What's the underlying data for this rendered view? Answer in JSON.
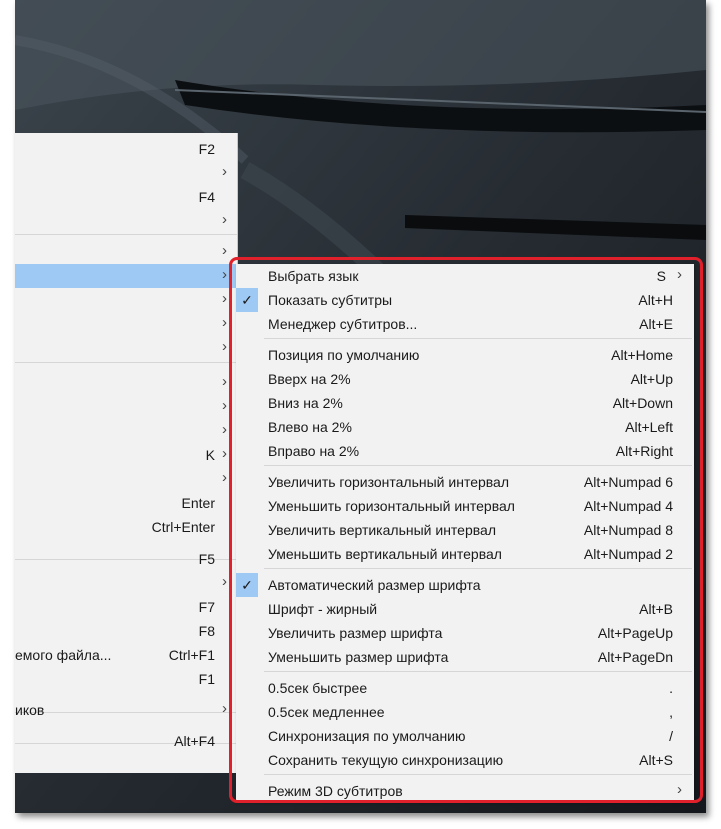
{
  "main_menu": {
    "rows": [
      {
        "left": "",
        "shortcut": "F2",
        "arrow": ""
      },
      {
        "left": "",
        "shortcut": "",
        "arrow": "›"
      },
      {
        "left": "",
        "shortcut": "F4",
        "arrow": ""
      },
      {
        "left": "",
        "shortcut": "",
        "arrow": "›"
      },
      {
        "left": "",
        "shortcut": "",
        "arrow": "›"
      },
      {
        "left": "",
        "shortcut": "",
        "arrow": "›"
      },
      {
        "left": "",
        "shortcut": "",
        "arrow": "›"
      },
      {
        "left": "",
        "shortcut": "",
        "arrow": "›"
      },
      {
        "left": "",
        "shortcut": "",
        "arrow": "›"
      },
      {
        "left": "",
        "shortcut": "",
        "arrow": "›"
      },
      {
        "left": "",
        "shortcut": "",
        "arrow": "›"
      },
      {
        "left": "",
        "shortcut": "",
        "arrow": "›"
      },
      {
        "left": "",
        "shortcut": "K",
        "arrow": "›"
      },
      {
        "left": "",
        "shortcut": "",
        "arrow": "›"
      },
      {
        "left": "",
        "shortcut": "Enter",
        "arrow": ""
      },
      {
        "left": "",
        "shortcut": "Ctrl+Enter",
        "arrow": ""
      },
      {
        "left": "",
        "shortcut": "F5",
        "arrow": ""
      },
      {
        "left": "",
        "shortcut": "",
        "arrow": "›"
      },
      {
        "left": "",
        "shortcut": "F7",
        "arrow": ""
      },
      {
        "left": "",
        "shortcut": "F8",
        "arrow": ""
      },
      {
        "left": "емого файла...",
        "shortcut": "Ctrl+F1",
        "arrow": ""
      },
      {
        "left": "",
        "shortcut": "F1",
        "arrow": ""
      },
      {
        "left": "иков",
        "shortcut": "",
        "arrow": "›"
      },
      {
        "left": "",
        "shortcut": "Alt+F4",
        "arrow": ""
      }
    ]
  },
  "subtitle_menu": {
    "items": [
      {
        "label": "Выбрать язык",
        "shortcut": "S",
        "arrow": "›",
        "checked": false
      },
      {
        "label": "Показать субтитры",
        "shortcut": "Alt+H",
        "arrow": "",
        "checked": true
      },
      {
        "label": "Менеджер субтитров...",
        "shortcut": "Alt+E",
        "arrow": "",
        "checked": false
      },
      {
        "label": "Позиция по умолчанию",
        "shortcut": "Alt+Home",
        "arrow": "",
        "checked": false
      },
      {
        "label": "Вверх на 2%",
        "shortcut": "Alt+Up",
        "arrow": "",
        "checked": false
      },
      {
        "label": "Вниз на 2%",
        "shortcut": "Alt+Down",
        "arrow": "",
        "checked": false
      },
      {
        "label": "Влево на 2%",
        "shortcut": "Alt+Left",
        "arrow": "",
        "checked": false
      },
      {
        "label": "Вправо на 2%",
        "shortcut": "Alt+Right",
        "arrow": "",
        "checked": false
      },
      {
        "label": "Увеличить горизонтальный интервал",
        "shortcut": "Alt+Numpad 6",
        "arrow": "",
        "checked": false
      },
      {
        "label": "Уменьшить горизонтальный интервал",
        "shortcut": "Alt+Numpad 4",
        "arrow": "",
        "checked": false
      },
      {
        "label": "Увеличить вертикальный интервал",
        "shortcut": "Alt+Numpad 8",
        "arrow": "",
        "checked": false
      },
      {
        "label": "Уменьшить вертикальный интервал",
        "shortcut": "Alt+Numpad 2",
        "arrow": "",
        "checked": false
      },
      {
        "label": "Автоматический размер шрифта",
        "shortcut": "",
        "arrow": "",
        "checked": true
      },
      {
        "label": "Шрифт - жирный",
        "shortcut": "Alt+B",
        "arrow": "",
        "checked": false
      },
      {
        "label": "Увеличить размер шрифта",
        "shortcut": "Alt+PageUp",
        "arrow": "",
        "checked": false
      },
      {
        "label": "Уменьшить размер шрифта",
        "shortcut": "Alt+PageDn",
        "arrow": "",
        "checked": false
      },
      {
        "label": "0.5сек быстрее",
        "shortcut": ".",
        "arrow": "",
        "checked": false
      },
      {
        "label": "0.5сек медленнее",
        "shortcut": ",",
        "arrow": "",
        "checked": false
      },
      {
        "label": "Синхронизация по умолчанию",
        "shortcut": "/",
        "arrow": "",
        "checked": false
      },
      {
        "label": "Сохранить текущую синхронизацию",
        "shortcut": "Alt+S",
        "arrow": "",
        "checked": false
      },
      {
        "label": "Режим 3D субтитров",
        "shortcut": "",
        "arrow": "›",
        "checked": false
      }
    ],
    "check_glyph": "✓"
  },
  "colors": {
    "highlight": "#9ec9f4",
    "annotation": "#e0202a",
    "menu_bg": "#f2f2f2"
  }
}
